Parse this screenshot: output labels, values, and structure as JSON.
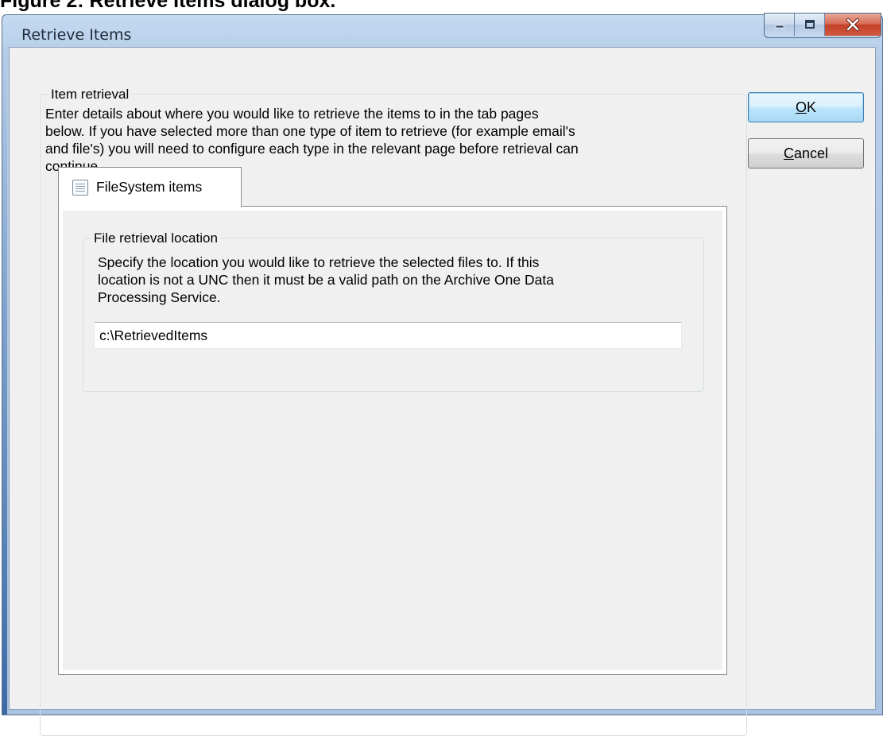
{
  "figure_caption": "Figure 2: Retrieve Items dialog box.",
  "window": {
    "title": "Retrieve Items",
    "caption_buttons": {
      "minimize_icon": "minimize-icon",
      "maximize_icon": "maximize-icon",
      "close_icon": "close-icon"
    }
  },
  "item_retrieval": {
    "legend": "Item retrieval",
    "description_lines": [
      "Enter details about where you would like to retrieve the items to in the tab pages",
      "below. If you have selected more than one type of item to retrieve (for example email's",
      "and file's) you will need to configure each type in the relevant page before retrieval can",
      "continue."
    ]
  },
  "tabs": [
    {
      "label": "FileSystem items",
      "icon": "list-page-icon",
      "selected": true
    }
  ],
  "file_retrieval": {
    "legend": "File retrieval location",
    "description_lines": [
      "Specify the location you would like to retrieve the selected files to. If this",
      "location is not a UNC then it must be a valid path on the Archive One Data",
      "Processing Service."
    ],
    "path_value": "c:\\RetrievedItems"
  },
  "buttons": {
    "ok": {
      "mnemonic": "O",
      "rest": "K",
      "default": true
    },
    "cancel": {
      "mnemonic": "C",
      "rest": "ancel"
    }
  },
  "colors": {
    "frame": "#b6cde8",
    "client_background": "#f0f0f0",
    "close_button": "#c3402a",
    "default_button_border": "#3c7fb1"
  }
}
